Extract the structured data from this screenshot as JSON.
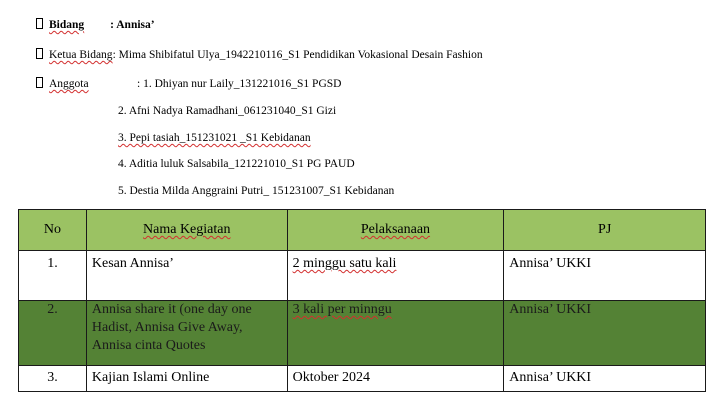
{
  "header": {
    "bidang": {
      "label": "Bidang",
      "value": ": Annisa’"
    },
    "ketua": {
      "label": "Ketua Bidang",
      "value": ": Mima Shibifatul Ulya_1942210116_S1 Pendidikan Vokasional Desain Fashion"
    },
    "anggota": {
      "label": "Anggota",
      "members": [
        ": 1. Dhiyan nur Laily_131221016_S1 PGSD",
        "2. Afni Nadya Ramadhani_061231040_S1 Gizi",
        "3. Pepi tasiah_151231021 _S1 Kebidanan",
        "4. Aditia luluk Salsabila_121221010_S1 PG PAUD",
        "5. Destia Milda Anggraini Putri_ 151231007_S1 Kebidanan"
      ]
    }
  },
  "table": {
    "headers": [
      "No",
      "Nama Kegiatan",
      "Pelaksanaan",
      "PJ"
    ],
    "rows": [
      {
        "no": "1.",
        "kegiatan": "Kesan Annisa’",
        "pelaksanaan": "2 minggu satu kali",
        "pj": "Annisa’ UKKI"
      },
      {
        "no": "2.",
        "kegiatan": "Annisa share it (one day one Hadist, Annisa Give Away, Annisa cinta Quotes",
        "pelaksanaan": "3 kali per minngu",
        "pj": "Annisa’ UKKI"
      },
      {
        "no": "3.",
        "kegiatan": "Kajian Islami Online",
        "pelaksanaan": "Oktober 2024",
        "pj": "Annisa’ UKKI"
      }
    ]
  },
  "colors": {
    "header_bg": "#9bc263",
    "highlight_row_bg": "#548235",
    "spellcheck_underline": "#d32f2f"
  }
}
